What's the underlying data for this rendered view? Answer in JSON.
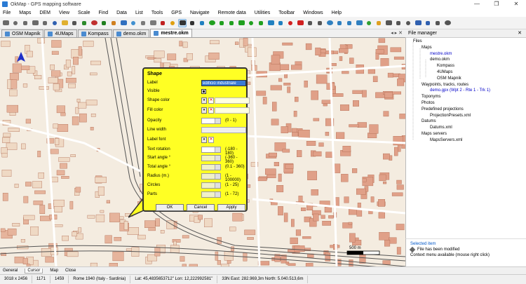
{
  "window": {
    "title": "OkMap - GPS mapping software",
    "controls": [
      "—",
      "❐",
      "✕"
    ]
  },
  "menu": [
    "File",
    "Maps",
    "DEM",
    "View",
    "Scale",
    "Find",
    "Data",
    "List",
    "Tools",
    "GPS",
    "Navigate",
    "Remote data",
    "Utilities",
    "Toolbar",
    "Windows",
    "Help"
  ],
  "toolbar": {
    "icons": [
      {
        "name": "map-search-icon",
        "color": "#6a6a6a"
      },
      {
        "name": "map-search-2-icon",
        "color": "#6a6a6a"
      },
      {
        "name": "move-icon",
        "color": "#6a6a6a"
      },
      {
        "name": "zoom-in-icon",
        "color": "#6a6a6a"
      },
      {
        "name": "zoom-out-icon",
        "color": "#6a6a6a"
      },
      {
        "name": "save-icon",
        "color": "#3060b0"
      },
      {
        "name": "open-folder-icon",
        "color": "#e0b030"
      },
      {
        "name": "print-icon",
        "color": "#555555"
      },
      {
        "name": "gps-icon",
        "color": "#2b8a2b"
      },
      {
        "name": "flag-icon",
        "color": "#c03030"
      },
      {
        "name": "route-icon",
        "color": "#208020"
      },
      {
        "name": "track-icon",
        "color": "#d08020"
      },
      {
        "name": "waypoint-icon",
        "color": "#3070c0"
      },
      {
        "name": "layers-icon",
        "color": "#4090d0"
      },
      {
        "name": "grid-icon",
        "color": "#7a7a7a"
      },
      {
        "name": "measure-icon",
        "color": "#7a7a7a"
      },
      {
        "name": "pin-icon",
        "color": "#c02020"
      },
      {
        "name": "star-icon",
        "color": "#e0a010"
      },
      {
        "name": "cursor-icon",
        "color": "#333333"
      },
      {
        "name": "crosshair-icon",
        "color": "#333333"
      },
      {
        "name": "node-icon",
        "color": "#2080c0"
      },
      {
        "name": "shape-icon",
        "color": "#20a020"
      },
      {
        "name": "polygon-icon",
        "color": "#20a020"
      },
      {
        "name": "line-icon",
        "color": "#20a020"
      },
      {
        "name": "text-icon",
        "color": "#20a020"
      },
      {
        "name": "image-icon",
        "color": "#20a020"
      },
      {
        "name": "circle-icon",
        "color": "#20a020"
      },
      {
        "name": "route-edit-icon",
        "color": "#2080c0"
      },
      {
        "name": "track-edit-icon",
        "color": "#2080c0"
      },
      {
        "name": "diamond-icon",
        "color": "#d02020"
      },
      {
        "name": "arrow-icon",
        "color": "#d02020"
      },
      {
        "name": "cut-icon",
        "color": "#555555"
      },
      {
        "name": "join-icon",
        "color": "#555555"
      },
      {
        "name": "globe-icon",
        "color": "#3080c0"
      },
      {
        "name": "plane-icon",
        "color": "#3080c0"
      },
      {
        "name": "walk-icon",
        "color": "#3080c0"
      },
      {
        "name": "bike-icon",
        "color": "#3080c0"
      },
      {
        "name": "flag-green-icon",
        "color": "#30a030"
      },
      {
        "name": "car-icon",
        "color": "#e0a020"
      },
      {
        "name": "export-icon",
        "color": "#555555"
      },
      {
        "name": "import-icon",
        "color": "#555555"
      },
      {
        "name": "settings-icon",
        "color": "#555555"
      },
      {
        "name": "help-icon",
        "color": "#3060b0"
      },
      {
        "name": "info-icon",
        "color": "#3060b0"
      },
      {
        "name": "pan-icon",
        "color": "#555555"
      },
      {
        "name": "home-icon",
        "color": "#555555"
      }
    ]
  },
  "tabs": [
    {
      "label": "OSM Mapnik",
      "active": false
    },
    {
      "label": "4UMaps",
      "active": false
    },
    {
      "label": "Kompass",
      "active": false
    },
    {
      "label": "demo.okm",
      "active": false
    },
    {
      "label": "mestre.okm",
      "active": true
    }
  ],
  "tab_controls": "◂ ▸ ✕",
  "map": {
    "scale_label": "500 m"
  },
  "dialog": {
    "title": "Shape",
    "label_label": "Label",
    "label_value": "edificio industriale",
    "visible_label": "Visible",
    "shape_color_label": "Shape color",
    "fill_color_label": "Fill color",
    "opacity_label": "Opacity",
    "opacity_range": "(0 - 1)",
    "line_width_label": "Line width",
    "label_font_label": "Label font",
    "text_rotation_label": "Text rotation",
    "text_rotation_range": "(-180 - 180)",
    "start_angle_label": "Start angle °",
    "start_angle_range": "(-360 - 360)",
    "total_angle_label": "Total angle °",
    "total_angle_range": "(0.1 - 360)",
    "radius_label": "Radius (m.)",
    "radius_range": "(1 - 100000)",
    "circles_label": "Circles",
    "circles_range": "(1 - 25)",
    "parts_label": "Parts",
    "parts_range": "(1 - 72)",
    "ok": "OK",
    "cancel": "Cancel",
    "apply": "Apply"
  },
  "file_manager": {
    "title": "File manager",
    "close": "✕",
    "tree": [
      {
        "label": "Files",
        "level": 0,
        "blue": false
      },
      {
        "label": "Maps",
        "level": 1,
        "blue": false
      },
      {
        "label": "mestre.okm",
        "level": 2,
        "blue": true
      },
      {
        "label": "demo.okm",
        "level": 2,
        "blue": false
      },
      {
        "label": "Kompass",
        "level": 3,
        "blue": false
      },
      {
        "label": "4UMaps",
        "level": 3,
        "blue": false
      },
      {
        "label": "OSM Mapnik",
        "level": 3,
        "blue": false
      },
      {
        "label": "Waypoints, tracks, routes",
        "level": 1,
        "blue": false
      },
      {
        "label": "demo.gpx (Wpt 2 - Rte 1 - Trk 1)",
        "level": 2,
        "blue": true
      },
      {
        "label": "Toponyms",
        "level": 1,
        "blue": false
      },
      {
        "label": "Photos",
        "level": 1,
        "blue": false
      },
      {
        "label": "Predefined projections",
        "level": 1,
        "blue": false
      },
      {
        "label": "ProjectionPresets.xml",
        "level": 2,
        "blue": false
      },
      {
        "label": "Datums",
        "level": 1,
        "blue": false
      },
      {
        "label": "Datums.xml",
        "level": 2,
        "blue": false
      },
      {
        "label": "Maps servers",
        "level": 1,
        "blue": false
      },
      {
        "label": "MapsServers.xml",
        "level": 2,
        "blue": false
      }
    ]
  },
  "selected_item": {
    "heading": "Selected item",
    "line1": "File has been modified",
    "line2": "Context menu available (mouse right click)"
  },
  "bottom_tabs": [
    {
      "label": "General",
      "active": false
    },
    {
      "label": "Cursor",
      "active": true
    },
    {
      "label": "Map",
      "active": false
    },
    {
      "label": "Close",
      "active": false
    }
  ],
  "status": [
    "3018 x 2456",
    "1171",
    "1459",
    "Rome 1940 (Italy - Sardinia)",
    "Lat: 45,4835653712\"  Lon: 12,222992581\"",
    "33N  East: 282.969,3m  North: 5.040.513,6m"
  ]
}
